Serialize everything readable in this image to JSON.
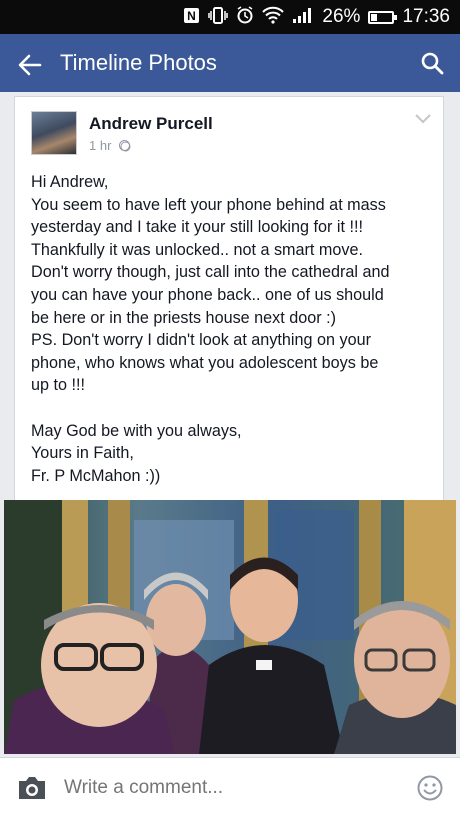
{
  "status_bar": {
    "battery": "26%",
    "battery_level": 0.26,
    "time": "17:36",
    "icons": [
      "nfc-icon",
      "vibrate-icon",
      "alarm-icon",
      "wifi-icon",
      "signal-icon",
      "battery-icon"
    ]
  },
  "app_bar": {
    "title": "Timeline Photos",
    "back_icon": "arrow-left-icon",
    "search_icon": "search-icon",
    "color": "#3b5998"
  },
  "post": {
    "author": "Andrew Purcell",
    "time": "1 hr",
    "privacy_icon": "globe-icon",
    "lines": [
      "Hi Andrew,",
      "You seem to have left your phone behind at mass",
      "yesterday and I take it your still looking for it !!!",
      "Thankfully it was unlocked.. not a smart move.",
      "Don't worry though, just call into the cathedral and",
      "you can have your phone back.. one of us should",
      "be here or in the priests house next door :)",
      "PS. Don't worry I didn't look at anything on your",
      "phone, who knows what you adolescent boys be",
      "up to !!!",
      "",
      "May God be with you always,",
      "Yours in Faith,",
      "Fr. P McMahon :))"
    ]
  },
  "comment_bar": {
    "placeholder": "Write a comment...",
    "camera_icon": "camera-icon",
    "emoji_icon": "smiley-icon"
  }
}
